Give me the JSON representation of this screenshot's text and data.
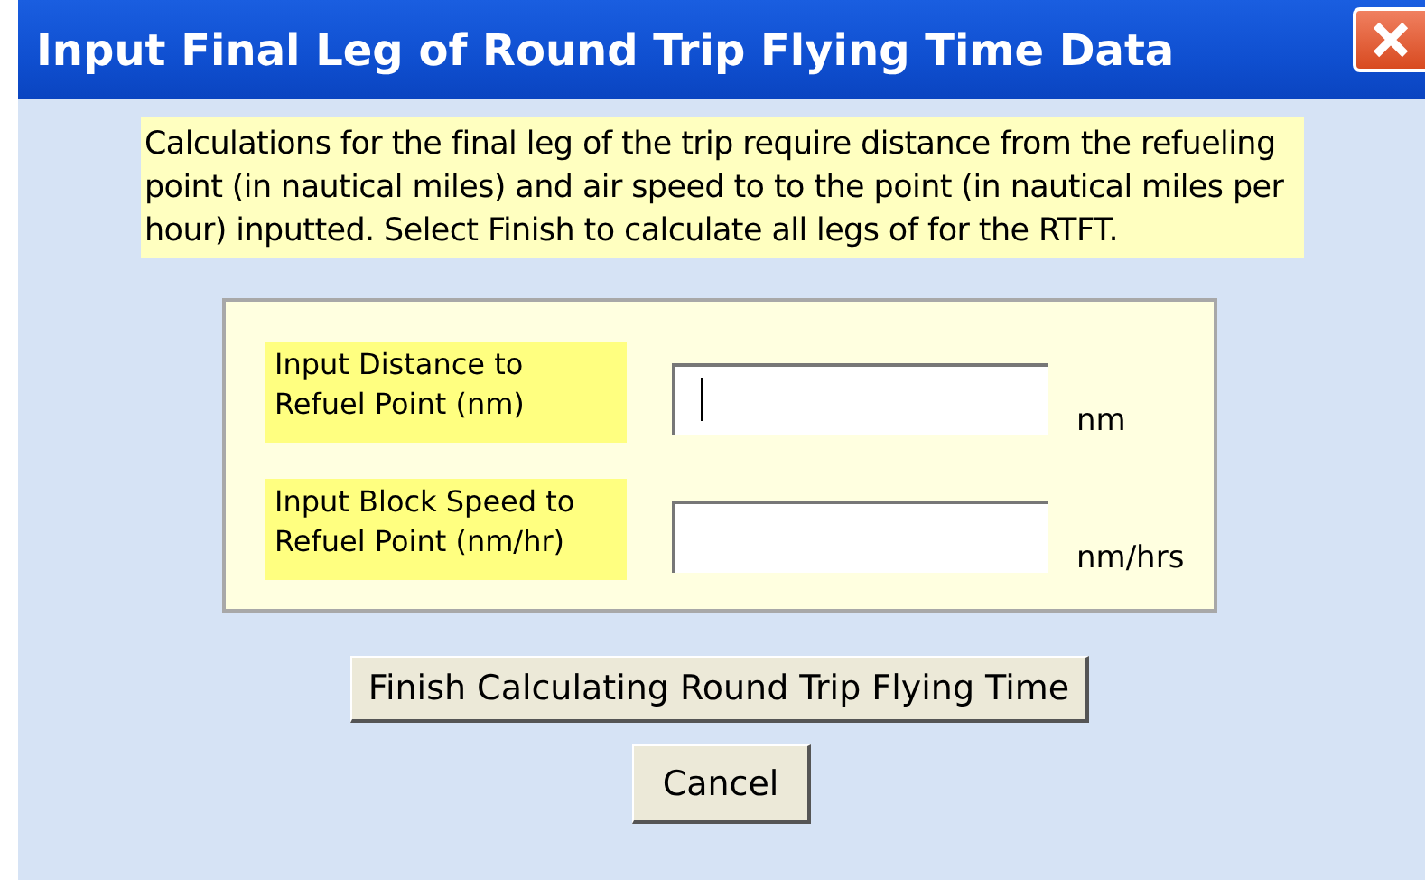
{
  "window": {
    "title": "Input Final Leg of Round Trip Flying Time Data"
  },
  "description": "Calculations for the final leg of the trip require distance from the refueling point (in nautical miles) and air speed to to the point (in nautical miles per hour) inputted.  Select Finish to calculate all legs of for the RTFT.",
  "fields": [
    {
      "label": "Input Distance to Refuel Point (nm)",
      "unit": "nm",
      "focused": true
    },
    {
      "label": "Input Block Speed to Refuel Point (nm/hr)",
      "unit": "nm/hrs",
      "focused": false
    }
  ],
  "buttons": [
    "Finish Calculating Round Trip Flying Time",
    "Cancel"
  ]
}
